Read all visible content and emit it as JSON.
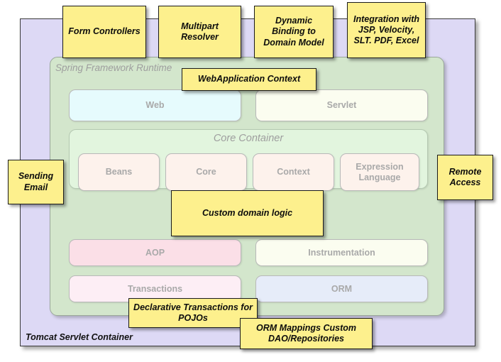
{
  "diagram": {
    "title": "Spring Framework Runtime architecture with annotation notes",
    "outer_container": {
      "label": "Tomcat Servlet Container",
      "color": "#ddd9f5"
    },
    "framework_container": {
      "label": "Spring Framework Runtime",
      "color": "#d3e6cc"
    },
    "core_container": {
      "label": "Core Container",
      "color": "#e2f5de",
      "modules": [
        {
          "label": "Beans",
          "color": "#fdf2ec"
        },
        {
          "label": "Core",
          "color": "#fdf2ec"
        },
        {
          "label": "Context",
          "color": "#fdf2ec"
        },
        {
          "label": "Expression Language",
          "color": "#fdf2ec"
        }
      ]
    },
    "web_row": [
      {
        "label": "Web",
        "color": "#e6fbfd"
      },
      {
        "label": "Servlet",
        "color": "#fbfdf0"
      }
    ],
    "aop_row": [
      {
        "label": "AOP",
        "color": "#fbdfe7"
      },
      {
        "label": "Instrumentation",
        "color": "#fbfdf0"
      }
    ],
    "data_row": [
      {
        "label": "Transactions",
        "color": "#fdeef5"
      },
      {
        "label": "ORM",
        "color": "#e6ecf9"
      }
    ],
    "notes": [
      {
        "id": "form-controllers",
        "text": "Form Controllers"
      },
      {
        "id": "multipart-resolver",
        "text": "Multipart Resolver"
      },
      {
        "id": "dynamic-binding",
        "text": "Dynamic Binding to Domain Model"
      },
      {
        "id": "integration",
        "text": "Integration with JSP, Velocity, SLT. PDF, Excel"
      },
      {
        "id": "webapplication-context",
        "text": "WebApplication Context"
      },
      {
        "id": "sending-email",
        "text": "Sending Email"
      },
      {
        "id": "remote-access",
        "text": "Remote Access"
      },
      {
        "id": "custom-domain-logic",
        "text": "Custom domain logic"
      },
      {
        "id": "declarative-transactions",
        "text": "Declarative Transactions for POJOs"
      },
      {
        "id": "orm-mappings",
        "text": "ORM Mappings Custom DAO/Repositories"
      }
    ],
    "note_colors": {
      "fill": "#fdf08d",
      "border": "#1b1b1b"
    }
  }
}
